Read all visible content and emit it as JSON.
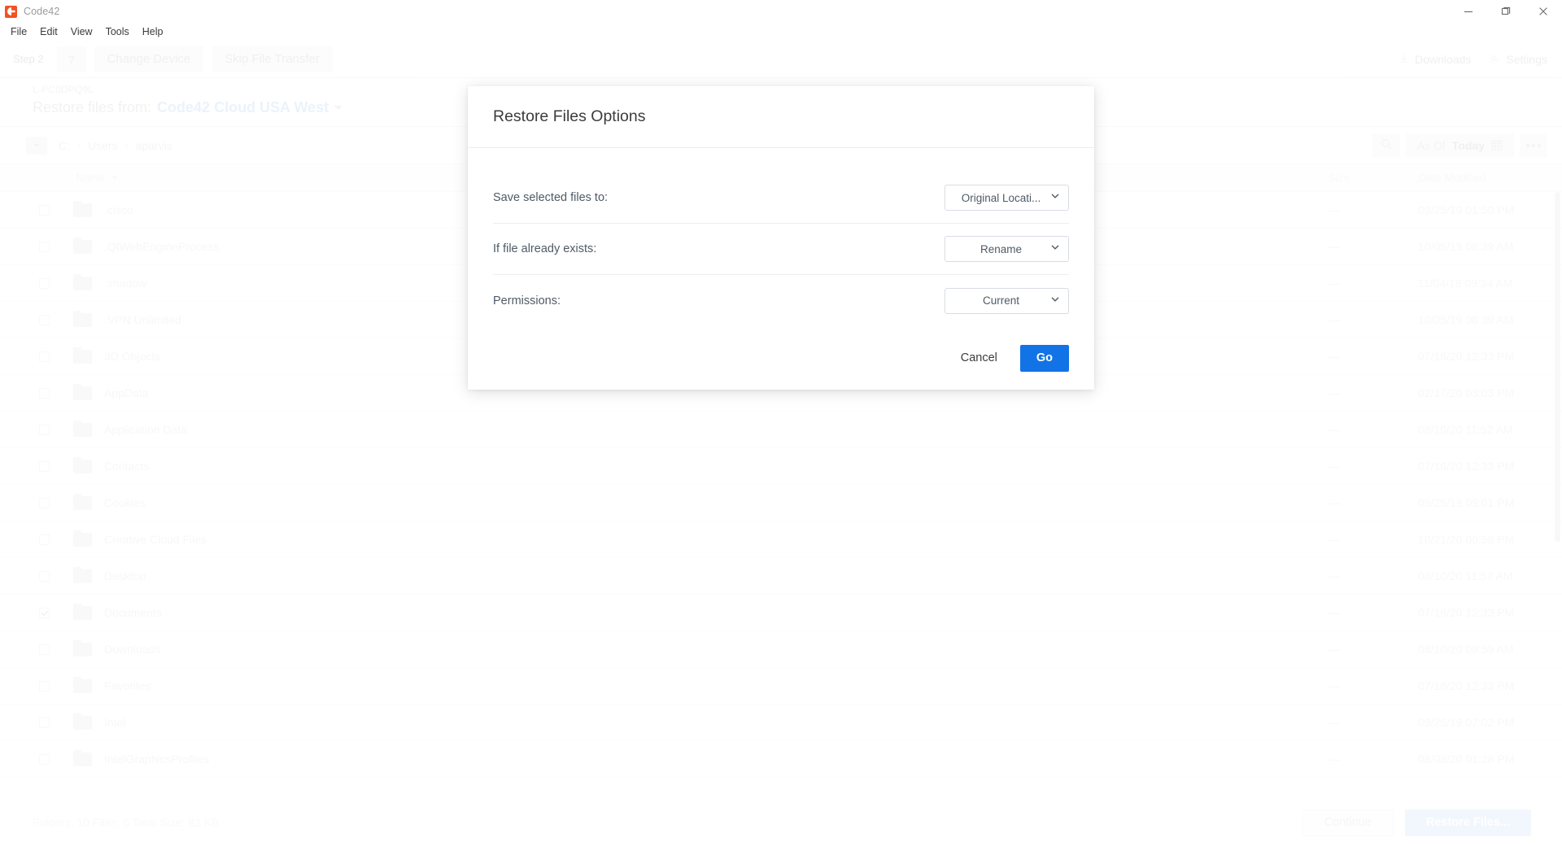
{
  "titlebar": {
    "app_title": "Code42",
    "logo_icon": "code42-logo-icon",
    "minimize_icon": "minimize-icon",
    "maximize_icon": "maximize-icon",
    "close_icon": "close-icon"
  },
  "menubar": {
    "items": [
      {
        "label": "File"
      },
      {
        "label": "Edit"
      },
      {
        "label": "View"
      },
      {
        "label": "Tools"
      },
      {
        "label": "Help"
      }
    ]
  },
  "step_toolbar": {
    "step_label": "Step 2",
    "help_label": "?",
    "change_device_label": "Change Device",
    "skip_file_transfer_label": "Skip File Transfer",
    "downloads_label": "Downloads",
    "settings_label": "Settings",
    "downloads_icon": "download-icon",
    "settings_icon": "gear-icon"
  },
  "restore_header": {
    "device_name": "L-PC0DPQ9L",
    "restore_from_prefix": "Restore files from:",
    "restore_source": "Code42 Cloud USA West",
    "caret_icon": "chevron-down-icon"
  },
  "breadcrumb": {
    "toggle_icon": "chevron-down-icon",
    "parts": [
      "C:",
      "Users",
      "aparvis"
    ],
    "separator": "›"
  },
  "list_toolbar": {
    "search_icon": "search-icon",
    "as_of_prefix": "As Of",
    "as_of_value": "Today",
    "calendar_icon": "calendar-icon",
    "overflow_icon": "more-options-icon"
  },
  "table": {
    "columns": {
      "name": "Name",
      "size": "Size",
      "date_modified": "Date Modified"
    },
    "sort_icon": "sort-descending-icon",
    "rows": [
      {
        "name": ".cisco",
        "size": "—",
        "date": "09/25/19 01:50 PM",
        "checked": false
      },
      {
        "name": ".QtWebEngineProcess",
        "size": "—",
        "date": "10/05/19 08:39 AM",
        "checked": false
      },
      {
        "name": ".shadow",
        "size": "—",
        "date": "11/04/19 09:34 AM",
        "checked": false
      },
      {
        "name": ".VPN Unlimited",
        "size": "—",
        "date": "10/05/19 08:39 AM",
        "checked": false
      },
      {
        "name": "3D Objects",
        "size": "—",
        "date": "07/16/20 12:33 PM",
        "checked": false
      },
      {
        "name": "AppData",
        "size": "—",
        "date": "02/17/20 03:03 PM",
        "checked": false
      },
      {
        "name": "Application Data",
        "size": "—",
        "date": "08/10/20 11:52 AM",
        "checked": false
      },
      {
        "name": "Contacts",
        "size": "—",
        "date": "07/16/20 12:33 PM",
        "checked": false
      },
      {
        "name": "Cookies",
        "size": "—",
        "date": "09/25/19 09:01 PM",
        "checked": false
      },
      {
        "name": "Creative Cloud Files",
        "size": "—",
        "date": "10/21/20 06:58 PM",
        "checked": false
      },
      {
        "name": "Desktop",
        "size": "—",
        "date": "08/10/20 11:57 AM",
        "checked": false
      },
      {
        "name": "Documents",
        "size": "—",
        "date": "07/16/20 12:33 PM",
        "checked": true
      },
      {
        "name": "Downloads",
        "size": "—",
        "date": "08/10/20 09:59 AM",
        "checked": false
      },
      {
        "name": "Favorites",
        "size": "—",
        "date": "07/16/20 12:33 PM",
        "checked": false
      },
      {
        "name": "Intel",
        "size": "—",
        "date": "09/25/19 07:02 PM",
        "checked": false
      },
      {
        "name": "IntelGraphicsProfiles",
        "size": "—",
        "date": "08/08/20 01:28 PM",
        "checked": false
      }
    ]
  },
  "statusbar": {
    "summary": "Folders: 10   Files: 6   Total Size: 82 KB",
    "continue_label": "Continue",
    "restore_files_label": "Restore Files..."
  },
  "modal": {
    "title": "Restore Files Options",
    "fields": [
      {
        "label": "Save selected files to:",
        "value": "Original Locati...",
        "name": "save-location-select",
        "chevron_icon": "chevron-down-icon"
      },
      {
        "label": "If file already exists:",
        "value": "Rename",
        "name": "file-exists-select",
        "chevron_icon": "chevron-down-icon"
      },
      {
        "label": "Permissions:",
        "value": "Current",
        "name": "permissions-select",
        "chevron_icon": "chevron-down-icon"
      }
    ],
    "cancel_label": "Cancel",
    "go_label": "Go",
    "accent_color": "#1273e6"
  }
}
